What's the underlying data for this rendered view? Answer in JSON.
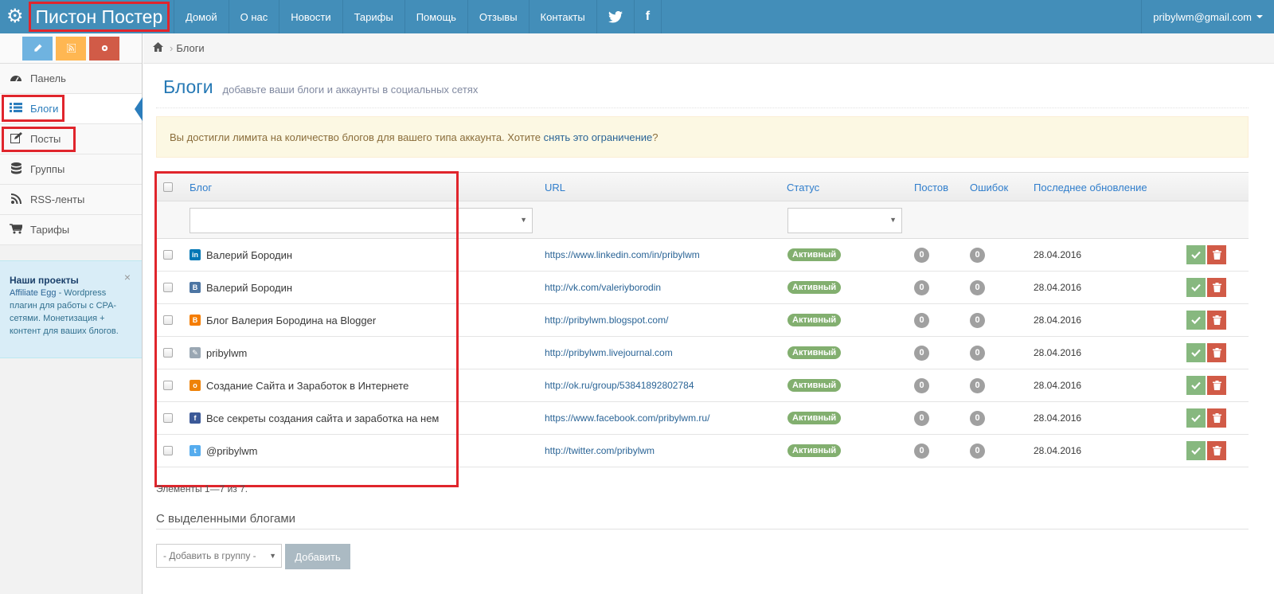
{
  "topbar": {
    "brand": "Пистон Постер",
    "nav": [
      "Домой",
      "О нас",
      "Новости",
      "Тарифы",
      "Помощь",
      "Отзывы",
      "Контакты"
    ],
    "twitter_glyph": "🐦",
    "facebook_glyph": "f",
    "user_email": "pribylwm@gmail.com"
  },
  "sidebar": {
    "items": [
      {
        "label": "Панель",
        "icon": "dashboard-icon"
      },
      {
        "label": "Блоги",
        "icon": "list-icon"
      },
      {
        "label": "Посты",
        "icon": "edit-icon"
      },
      {
        "label": "Группы",
        "icon": "database-icon"
      },
      {
        "label": "RSS-ленты",
        "icon": "rss-icon"
      },
      {
        "label": "Тарифы",
        "icon": "cart-icon"
      }
    ],
    "projects": {
      "title": "Наши проекты",
      "link": "Affiliate Egg",
      "text": " - Wordpress плагин для работы с CPA-сетями. Монетизация + контент для ваших блогов.",
      "close": "×"
    }
  },
  "breadcrumb": {
    "current": "Блоги"
  },
  "header": {
    "title": "Блоги",
    "subtitle": "добавьте ваши блоги и аккаунты в социальных сетях"
  },
  "alert": {
    "text_before": "Вы достигли лимита на количество блогов для вашего типа аккаунта. Хотите ",
    "link": "снять это ограничение",
    "text_after": "?"
  },
  "table": {
    "headers": {
      "blog": "Блог",
      "url": "URL",
      "status": "Статус",
      "posts": "Постов",
      "errors": "Ошибок",
      "updated": "Последнее обновление"
    },
    "rows": [
      {
        "network": "linkedin",
        "icon_letter": "in",
        "color": "#0077b5",
        "name": "Валерий Бородин",
        "url": "https://www.linkedin.com/in/pribylwm",
        "status": "Активный",
        "posts": "0",
        "errors": "0",
        "date": "28.04.2016"
      },
      {
        "network": "vk",
        "icon_letter": "B",
        "color": "#4c75a3",
        "name": "Валерий Бородин",
        "url": "http://vk.com/valeriyborodin",
        "status": "Активный",
        "posts": "0",
        "errors": "0",
        "date": "28.04.2016"
      },
      {
        "network": "blogger",
        "icon_letter": "B",
        "color": "#f57d00",
        "name": "Блог Валерия Бородина на Blogger",
        "url": "http://pribylwm.blogspot.com/",
        "status": "Активный",
        "posts": "0",
        "errors": "0",
        "date": "28.04.2016"
      },
      {
        "network": "livejournal",
        "icon_letter": "✎",
        "color": "#9aa7b3",
        "name": "pribylwm",
        "url": "http://pribylwm.livejournal.com",
        "status": "Активный",
        "posts": "0",
        "errors": "0",
        "date": "28.04.2016"
      },
      {
        "network": "odnoklassniki",
        "icon_letter": "о",
        "color": "#ee8208",
        "name": "Создание Сайта и Заработок в Интернете",
        "url": "http://ok.ru/group/53841892802784",
        "status": "Активный",
        "posts": "0",
        "errors": "0",
        "date": "28.04.2016"
      },
      {
        "network": "facebook",
        "icon_letter": "f",
        "color": "#3b5998",
        "name": "Все секреты создания сайта и заработка на нем",
        "url": "https://www.facebook.com/pribylwm.ru/",
        "status": "Активный",
        "posts": "0",
        "errors": "0",
        "date": "28.04.2016"
      },
      {
        "network": "twitter",
        "icon_letter": "t",
        "color": "#55acee",
        "name": "@pribylwm",
        "url": "http://twitter.com/pribylwm",
        "status": "Активный",
        "posts": "0",
        "errors": "0",
        "date": "28.04.2016"
      }
    ]
  },
  "summary": "Элементы 1—7 из 7.",
  "bulk": {
    "title": "С выделенными блогами",
    "select_value": "- Добавить в группу -",
    "button": "Добавить"
  },
  "colors": {
    "topbar": "#438eb9",
    "highlight": "#e0252c",
    "link": "#2a6496",
    "status_active": "#82af6f"
  }
}
